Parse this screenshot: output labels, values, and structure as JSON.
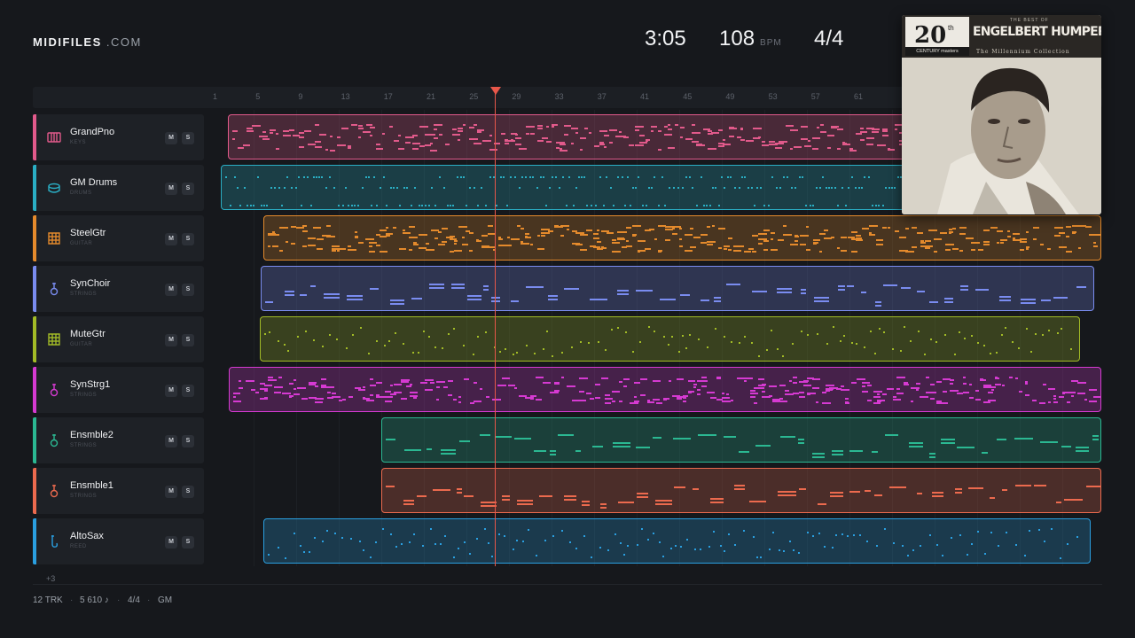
{
  "header": {
    "logo_bold": "MIDIFILES",
    "logo_suffix": ".COM",
    "time": "3:05",
    "bpm": "108",
    "bpm_unit": "BPM",
    "meter": "4/4"
  },
  "ruler_ticks": [
    "1",
    "5",
    "9",
    "13",
    "17",
    "21",
    "25",
    "29",
    "33",
    "37",
    "41",
    "45",
    "49",
    "53",
    "57",
    "61"
  ],
  "tracks": [
    {
      "name": "GrandPno",
      "category": "KEYS",
      "icon": "piano-icon",
      "color": "#e25a8b",
      "mute": "M",
      "solo": "S"
    },
    {
      "name": "GM Drums",
      "category": "DRUMS",
      "icon": "drum-icon",
      "color": "#2aaec4",
      "mute": "M",
      "solo": "S"
    },
    {
      "name": "SteelGtr",
      "category": "GUITAR",
      "icon": "guitar-icon",
      "color": "#e48a2c",
      "mute": "M",
      "solo": "S"
    },
    {
      "name": "SynChoir",
      "category": "STRINGS",
      "icon": "violin-icon",
      "color": "#7a8cf0",
      "mute": "M",
      "solo": "S"
    },
    {
      "name": "MuteGtr",
      "category": "GUITAR",
      "icon": "guitar-icon",
      "color": "#a2bb26",
      "mute": "M",
      "solo": "S"
    },
    {
      "name": "SynStrg1",
      "category": "STRINGS",
      "icon": "violin-icon",
      "color": "#d63ad2",
      "mute": "M",
      "solo": "S"
    },
    {
      "name": "Ensmble2",
      "category": "STRINGS",
      "icon": "violin-icon",
      "color": "#2bb892",
      "mute": "M",
      "solo": "S"
    },
    {
      "name": "Ensmble1",
      "category": "STRINGS",
      "icon": "violin-icon",
      "color": "#ec6a4e",
      "mute": "M",
      "solo": "S"
    },
    {
      "name": "AltoSax",
      "category": "REED",
      "icon": "sax-icon",
      "color": "#2a9fe0",
      "mute": "M",
      "solo": "S"
    }
  ],
  "more_tracks": "+3",
  "footer": {
    "tracks": "12 TRK",
    "notes": "5 610 ♪",
    "meter": "4/4",
    "standard": "GM",
    "separator": "·"
  },
  "album": {
    "badge_number": "20",
    "badge_suffix": "th",
    "badge_label": "CENTURY masters",
    "best_of": "THE BEST OF",
    "artist": "ENGELBERT HUMPERDINCK",
    "subtitle": "The Millennium Collection"
  }
}
